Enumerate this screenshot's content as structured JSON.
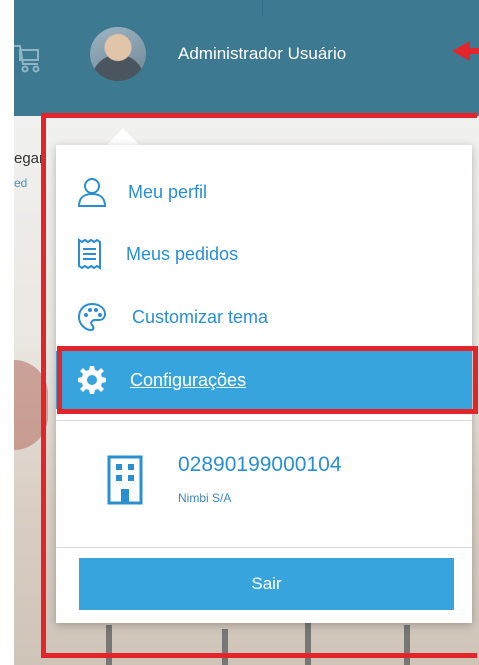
{
  "header": {
    "user_name": "Administrador Usuário"
  },
  "background": {
    "text_fragment_1": "egar",
    "text_fragment_2": "ed"
  },
  "menu": {
    "items": [
      {
        "label": "Meu perfil",
        "icon": "user-icon"
      },
      {
        "label": "Meus pedidos",
        "icon": "receipt-icon"
      },
      {
        "label": "Customizar tema",
        "icon": "palette-icon"
      },
      {
        "label": "Configurações",
        "icon": "gear-icon",
        "active": true
      }
    ]
  },
  "company": {
    "cnpj": "02890199000104",
    "name": "Nimbi S/A",
    "icon": "building-icon"
  },
  "logout": {
    "label": "Sair"
  },
  "colors": {
    "header_bg": "#3d7a91",
    "accent_blue": "#38a4dd",
    "link_blue": "#2a8fd1",
    "annotation_red": "#e4242b"
  }
}
